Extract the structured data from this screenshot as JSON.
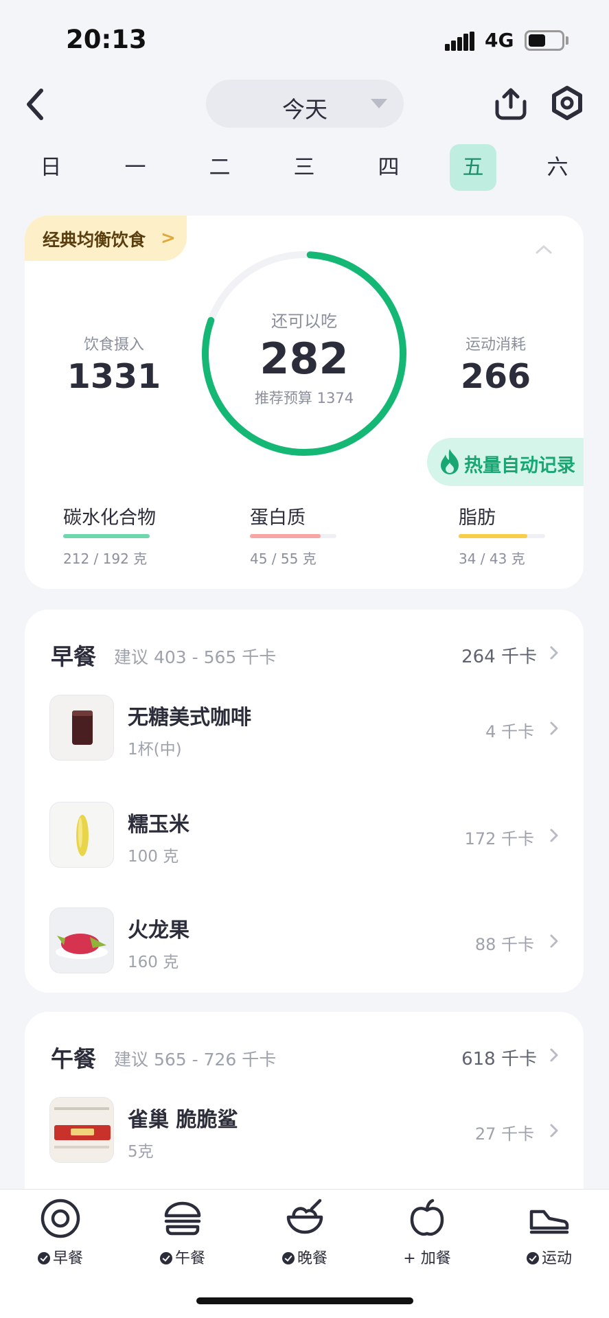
{
  "status_bar": {
    "time": "20:13",
    "network": "4G"
  },
  "header": {
    "date_label": "今天"
  },
  "weekdays": [
    "日",
    "一",
    "二",
    "三",
    "四",
    "五",
    "六"
  ],
  "selected_weekday": "五",
  "summary": {
    "diet_tag": "经典均衡饮食",
    "intake_label": "饮食摄入",
    "intake_value": "1331",
    "remaining_label": "还可以吃",
    "remaining_value": "282",
    "budget_text": "推荐预算 1374",
    "burn_label": "运动消耗",
    "burn_value": "266",
    "auto_record_label": "热量自动记录",
    "macros": [
      {
        "name": "碳水化合物",
        "amount": "212 / 192 克",
        "progress": 1.0,
        "color": "#6fd7ad"
      },
      {
        "name": "蛋白质",
        "amount": "45 / 55 克",
        "progress": 0.82,
        "color": "#f6a6a4"
      },
      {
        "name": "脂肪",
        "amount": "34 / 43 克",
        "progress": 0.79,
        "color": "#f7cd4a"
      }
    ]
  },
  "breakfast": {
    "title": "早餐",
    "suggest": "建议 403 - 565 千卡",
    "total": "264 千卡",
    "items": [
      {
        "name": "无糖美式咖啡",
        "amount": "1杯(中)",
        "kcal": "4 千卡"
      },
      {
        "name": "糯玉米",
        "amount": "100 克",
        "kcal": "172 千卡"
      },
      {
        "name": "火龙果",
        "amount": "160 克",
        "kcal": "88 千卡"
      }
    ]
  },
  "lunch": {
    "title": "午餐",
    "suggest": "建议 565 - 726 千卡",
    "total": "618 千卡",
    "items": [
      {
        "name": "雀巢 脆脆鲨",
        "amount": "5克",
        "kcal": "27 千卡"
      }
    ]
  },
  "bottom_nav": [
    {
      "label": "早餐",
      "checked": true,
      "icon": "egg-icon"
    },
    {
      "label": "午餐",
      "checked": true,
      "icon": "burger-icon"
    },
    {
      "label": "晚餐",
      "checked": true,
      "icon": "bowl-icon"
    },
    {
      "label": "+ 加餐",
      "checked": false,
      "icon": "apple-icon"
    },
    {
      "label": "运动",
      "checked": true,
      "icon": "sneaker-icon"
    }
  ]
}
